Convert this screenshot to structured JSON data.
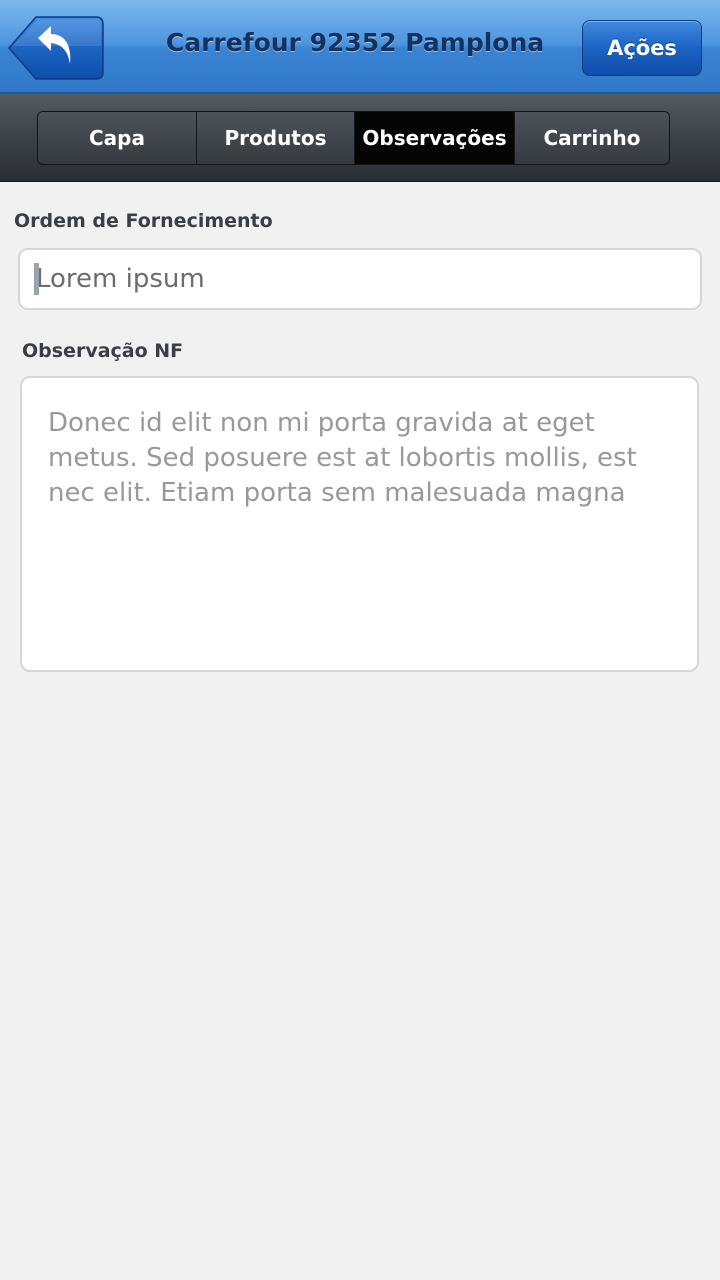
{
  "header": {
    "title": "Carrefour 92352 Pamplona",
    "back_icon": "back-arrow-icon",
    "actions_label": "Ações",
    "colors": {
      "header_blue": "#3a84d4",
      "title_text": "#14325d",
      "button_blue": "#1c63c2"
    }
  },
  "tabs": [
    {
      "label": "Capa",
      "active": false
    },
    {
      "label": "Produtos",
      "active": false
    },
    {
      "label": "Observações",
      "active": true
    },
    {
      "label": "Carrinho",
      "active": false
    }
  ],
  "form": {
    "ordem_label": "Ordem de Fornecimento",
    "ordem_value": "Lorem ipsum",
    "observacao_label": "Observação NF",
    "observacao_value": "Donec id elit non mi porta gravida at eget metus. Sed posuere est at lobortis mollis, est nec elit. Etiam porta sem malesuada magna"
  }
}
